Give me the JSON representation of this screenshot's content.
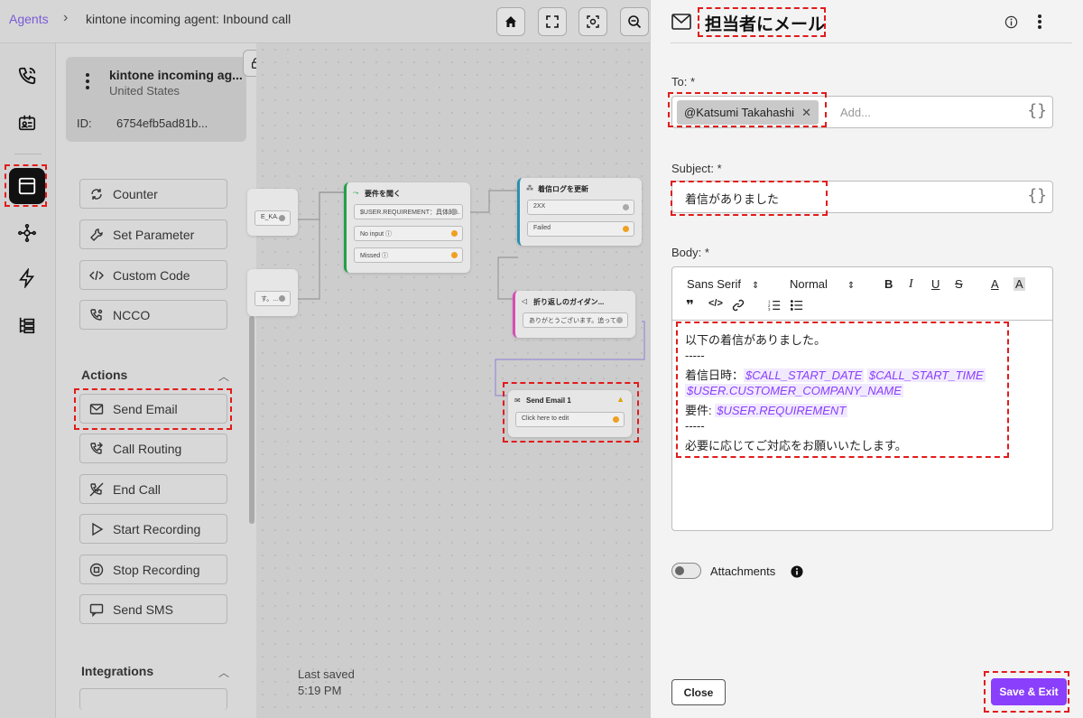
{
  "breadcrumb": {
    "root": "Agents",
    "separator": "›",
    "title": "kintone incoming agent: Inbound call"
  },
  "agent": {
    "name": "kintone incoming ag...",
    "region": "United States",
    "id_label": "ID:",
    "id_value": "6754efb5ad81b..."
  },
  "palette": {
    "misc_items": [
      "Counter",
      "Set Parameter",
      "Custom Code",
      "NCCO"
    ],
    "actions_header": "Actions",
    "action_items": [
      "Send Email",
      "Call Routing",
      "End Call",
      "Start Recording",
      "Stop Recording",
      "Send SMS"
    ],
    "integrations_header": "Integrations"
  },
  "last_saved": {
    "label": "Last saved",
    "time": "5:19 PM"
  },
  "canvas": {
    "node_a_port1": "E_KA...",
    "node_b_port1": "す。...",
    "node_requirement": {
      "title": "要件を聞く",
      "ports": [
        "$USER.REQUIREMENT：具体的...",
        "No input ⓘ",
        "Missed ⓘ"
      ]
    },
    "node_log": {
      "title": "着信ログを更新",
      "ports": [
        "2XX",
        "Failed"
      ]
    },
    "node_guidance": {
      "title": "折り返しのガイダン...",
      "ports": [
        "ありがとうございます。追って..."
      ]
    },
    "node_email": {
      "title": "Send Email 1",
      "ports": [
        "Click here to edit"
      ]
    }
  },
  "panel": {
    "title": "担当者にメール",
    "to_label": "To: *",
    "to_chip": "@Katsumi Takahashi",
    "to_placeholder": "Add...",
    "braces": "{}",
    "subject_label": "Subject: *",
    "subject_value": "着信がありました",
    "body_label": "Body: *",
    "font_select": "Sans Serif",
    "size_select": "Normal",
    "body": {
      "line1": "以下の着信がありました。",
      "dash1": "-----",
      "line3_prefix": "着信日時：",
      "var_start_date": "$CALL_START_DATE",
      "var_start_time": "$CALL_START_TIME",
      "var_company": "$USER.CUSTOMER_COMPANY_NAME",
      "line5_prefix": "要件: ",
      "var_requirement": "$USER.REQUIREMENT",
      "dash2": "-----",
      "line7": "必要に応じてご対応をお願いいたします。"
    },
    "attachments_label": "Attachments",
    "close_label": "Close",
    "save_label": "Save & Exit"
  },
  "colors": {
    "accent": "#8a3ffc",
    "highlight": "#e21b1b"
  }
}
